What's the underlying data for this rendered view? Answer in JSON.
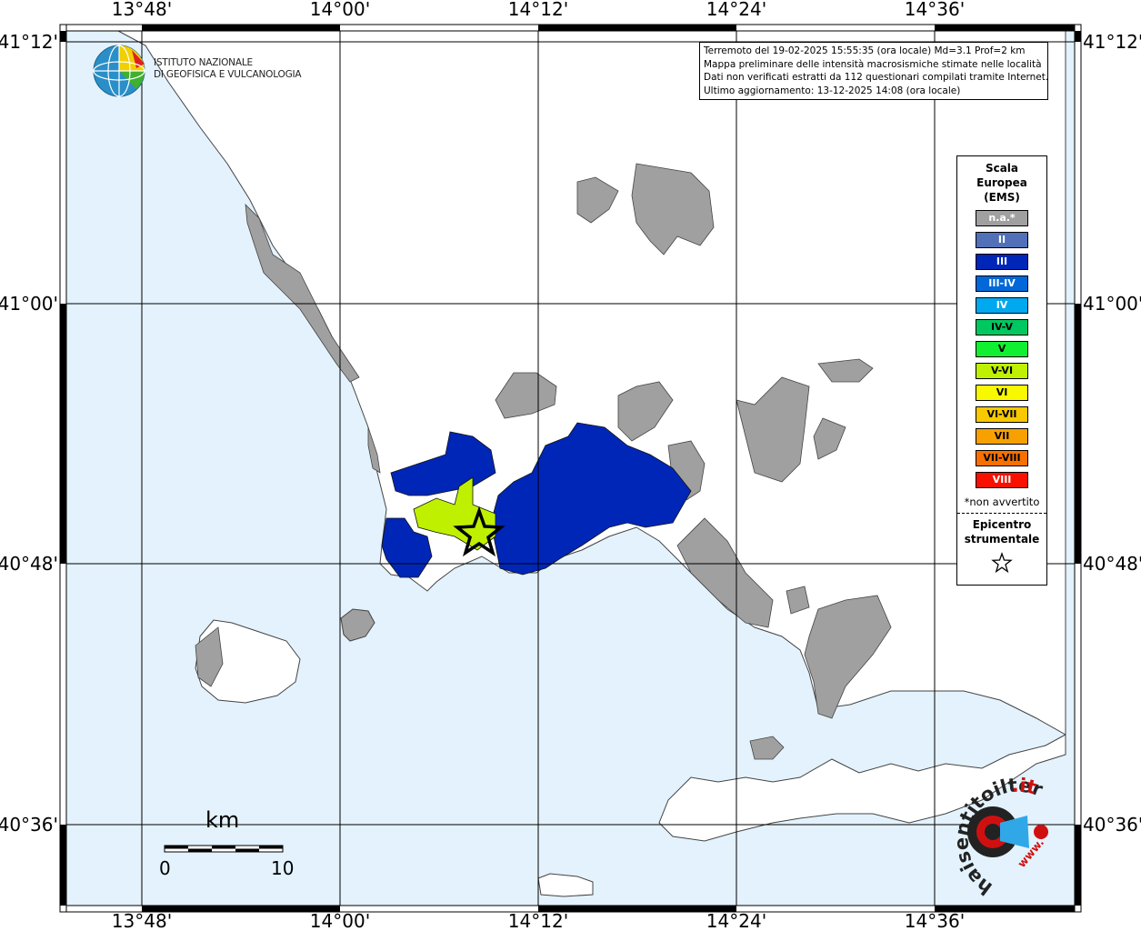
{
  "map": {
    "lon_ticks": [
      "13°48'",
      "14°00'",
      "14°12'",
      "14°24'",
      "14°36'"
    ],
    "lat_ticks": [
      "41°12'",
      "41°00'",
      "40°48'",
      "40°36'"
    ],
    "colors": {
      "sea": "#e3f2fd",
      "land": "#ffffff",
      "na": "#a0a0a0",
      "int_III": "#0026b8",
      "int_V_VI": "#bff000"
    }
  },
  "info": {
    "line1": "Terremoto del 19-02-2025 15:55:35 (ora locale) Md=3.1 Prof=2 km",
    "line2": "Mappa preliminare delle intensità macrosismiche stimate nelle località",
    "line3": "Dati non verificati estratti da 112 questionari compilati tramite Internet.",
    "line4": "Ultimo aggiornamento: 13-12-2025 14:08 (ora locale)"
  },
  "logo": {
    "line1": "ISTITUTO NAZIONALE",
    "line2": "DI GEOFISICA E VULCANOLOGIA"
  },
  "legend": {
    "title_lines": [
      "Scala",
      "Europea",
      "(EMS)"
    ],
    "items": [
      {
        "label": "n.a.*",
        "color": "#a0a0a0",
        "text": "#ffffff"
      },
      {
        "label": "II",
        "color": "#5170b8",
        "text": "#ffffff"
      },
      {
        "label": "III",
        "color": "#0026b8",
        "text": "#ffffff"
      },
      {
        "label": "III-IV",
        "color": "#0068d8",
        "text": "#ffffff"
      },
      {
        "label": "IV",
        "color": "#00a8f0",
        "text": "#ffffff"
      },
      {
        "label": "IV-V",
        "color": "#00c860",
        "text": "#000000"
      },
      {
        "label": "V",
        "color": "#10f030",
        "text": "#000000"
      },
      {
        "label": "V-VI",
        "color": "#bff000",
        "text": "#000000"
      },
      {
        "label": "VI",
        "color": "#f8f800",
        "text": "#000000"
      },
      {
        "label": "VI-VII",
        "color": "#f8c800",
        "text": "#000000"
      },
      {
        "label": "VII",
        "color": "#f8a000",
        "text": "#000000"
      },
      {
        "label": "VII-VIII",
        "color": "#f87000",
        "text": "#000000"
      },
      {
        "label": "VIII",
        "color": "#f81000",
        "text": "#ffffff"
      }
    ],
    "note": "*non avvertito",
    "epicenter_lines": [
      "Epicentro",
      "strumentale"
    ]
  },
  "scalebar": {
    "unit": "km",
    "min": "0",
    "max": "10"
  },
  "brand": {
    "text_main": "haisentitoilterremoto",
    "text_tld": ".it",
    "text_url": "www."
  }
}
